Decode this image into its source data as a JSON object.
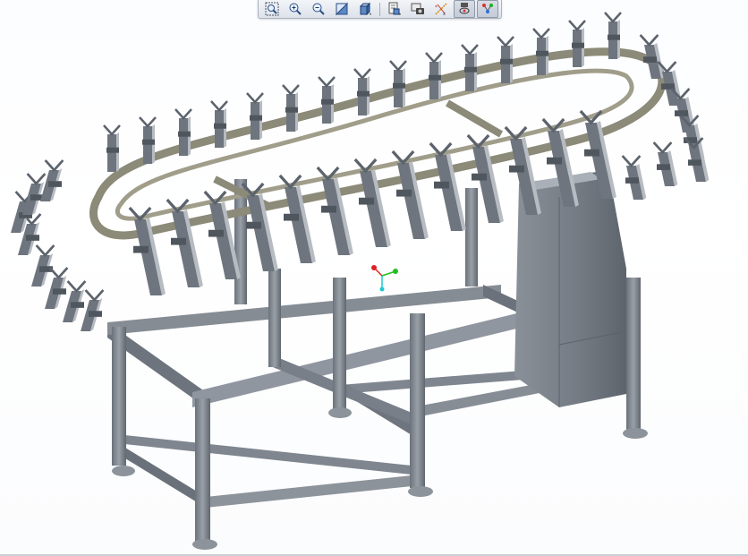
{
  "window": {
    "title": ""
  },
  "toolbar": {
    "buttons": [
      {
        "id": "zoom-window",
        "icon": "zoom-window-icon"
      },
      {
        "id": "zoom-in",
        "icon": "zoom-in-icon"
      },
      {
        "id": "zoom-out",
        "icon": "zoom-out-icon"
      },
      {
        "id": "refit",
        "icon": "refit-icon"
      },
      {
        "id": "display-style",
        "icon": "display-style-icon"
      },
      {
        "id": "saved-orientations",
        "icon": "saved-orientations-icon"
      },
      {
        "id": "view-manager",
        "icon": "view-manager-icon"
      },
      {
        "id": "datum-display",
        "icon": "datum-display-icon"
      },
      {
        "id": "spin-center",
        "icon": "spin-center-icon"
      },
      {
        "id": "annotation-display",
        "icon": "annotation-display-icon"
      }
    ]
  },
  "model": {
    "name": "",
    "colors": {
      "frame": "#7f868f",
      "frame_dark": "#5c636c",
      "frame_light": "#a9afb6",
      "track": "#8c8a78",
      "holder": "#6e757e",
      "holder_light": "#b7bcc2",
      "cabinet": "#7b828b",
      "axis_x": "#e02020",
      "axis_y": "#20c020",
      "axis_z": "#20c8d0"
    }
  }
}
